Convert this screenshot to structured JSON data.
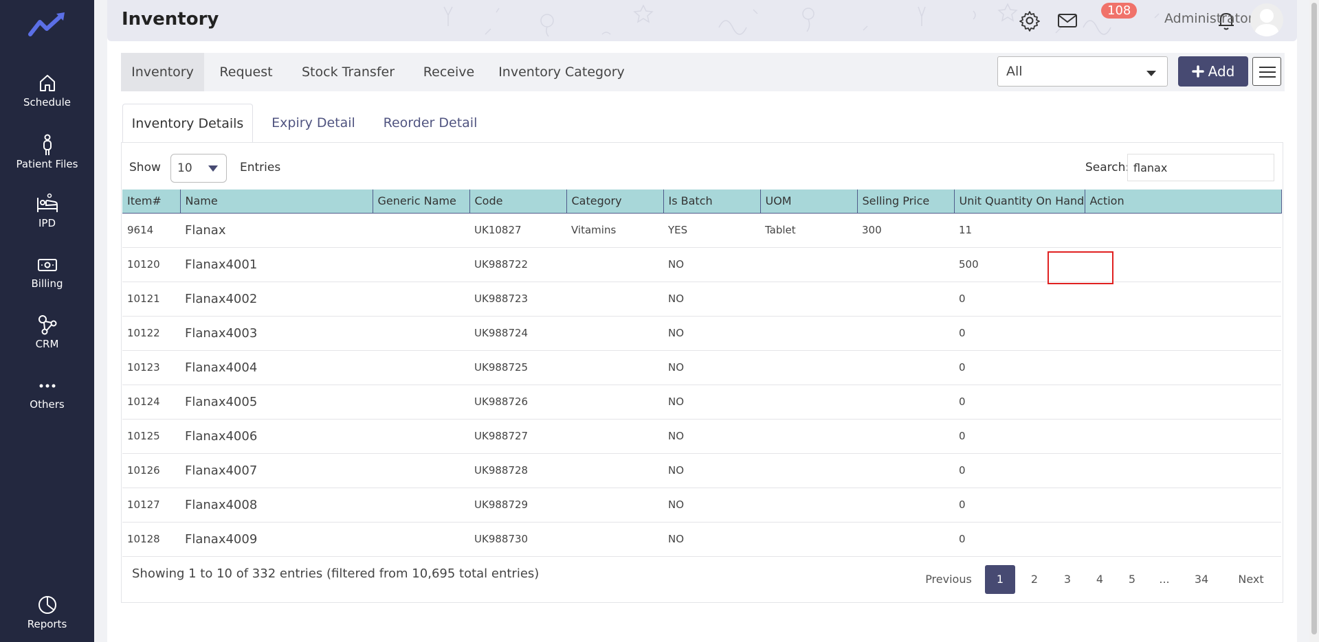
{
  "colors": {
    "sidebar": "#23283f",
    "accent": "#474a72",
    "table_header": "#a8d7d9",
    "badge": "#f0726a",
    "highlight": "#e02020"
  },
  "sidebar": {
    "logo": "trend-logo-icon",
    "items": [
      {
        "label": "Schedule",
        "icon": "home-icon"
      },
      {
        "label": "Patient Files",
        "icon": "person-icon"
      },
      {
        "label": "IPD",
        "icon": "bed-icon"
      },
      {
        "label": "Billing",
        "icon": "money-icon"
      },
      {
        "label": "CRM",
        "icon": "network-icon"
      },
      {
        "label": "Others",
        "icon": "more-dots-icon"
      }
    ],
    "footer_item": {
      "label": "Reports",
      "icon": "pie-chart-icon"
    }
  },
  "header": {
    "title": "Inventory",
    "notification_count": "108",
    "user_name": "Administrator"
  },
  "module_tabs": [
    "Inventory",
    "Request",
    "Stock Transfer",
    "Receive",
    "Inventory Category"
  ],
  "filter": {
    "selected": "All"
  },
  "add_label": "Add",
  "sub_tabs": [
    "Inventory Details",
    "Expiry Detail",
    "Reorder Detail"
  ],
  "controls": {
    "show_label": "Show",
    "entries_value": "10",
    "entries_label": "Entries",
    "search_label": "Search:",
    "search_value": "flanax"
  },
  "table": {
    "columns": [
      "Item#",
      "Name",
      "Generic Name",
      "Code",
      "Category",
      "Is Batch",
      "UOM",
      "Selling Price",
      "Unit Quantity On Hand",
      "Action"
    ],
    "rows": [
      [
        "9614",
        "Flanax",
        "",
        "UK10827",
        "Vitamins",
        "YES",
        "Tablet",
        "300",
        "11",
        ""
      ],
      [
        "10120",
        "Flanax4001",
        "",
        "UK988722",
        "",
        "NO",
        "",
        "",
        "500",
        ""
      ],
      [
        "10121",
        "Flanax4002",
        "",
        "UK988723",
        "",
        "NO",
        "",
        "",
        "0",
        ""
      ],
      [
        "10122",
        "Flanax4003",
        "",
        "UK988724",
        "",
        "NO",
        "",
        "",
        "0",
        ""
      ],
      [
        "10123",
        "Flanax4004",
        "",
        "UK988725",
        "",
        "NO",
        "",
        "",
        "0",
        ""
      ],
      [
        "10124",
        "Flanax4005",
        "",
        "UK988726",
        "",
        "NO",
        "",
        "",
        "0",
        ""
      ],
      [
        "10125",
        "Flanax4006",
        "",
        "UK988727",
        "",
        "NO",
        "",
        "",
        "0",
        ""
      ],
      [
        "10126",
        "Flanax4007",
        "",
        "UK988728",
        "",
        "NO",
        "",
        "",
        "0",
        ""
      ],
      [
        "10127",
        "Flanax4008",
        "",
        "UK988729",
        "",
        "NO",
        "",
        "",
        "0",
        ""
      ],
      [
        "10128",
        "Flanax4009",
        "",
        "UK988730",
        "",
        "NO",
        "",
        "",
        "0",
        ""
      ]
    ]
  },
  "footer": {
    "showing_text": "Showing 1 to 10 of 332 entries (filtered from 10,695 total entries)",
    "pagination": [
      "Previous",
      "1",
      "2",
      "3",
      "4",
      "5",
      "...",
      "34",
      "Next"
    ],
    "active_page": "1"
  }
}
